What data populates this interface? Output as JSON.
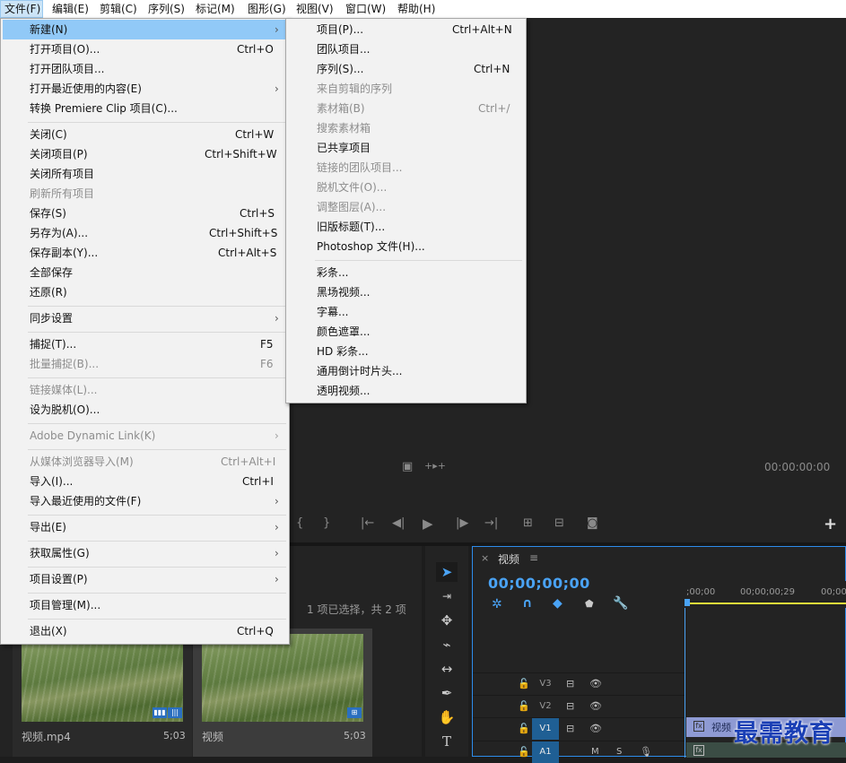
{
  "menubar": {
    "items": [
      "文件(F)",
      "编辑(E)",
      "剪辑(C)",
      "序列(S)",
      "标记(M)",
      "图形(G)",
      "视图(V)",
      "窗口(W)",
      "帮助(H)"
    ]
  },
  "file_menu": {
    "new": {
      "label": "新建(N)"
    },
    "open_project": {
      "label": "打开项目(O)...",
      "shortcut": "Ctrl+O"
    },
    "open_team_project": {
      "label": "打开团队项目..."
    },
    "open_recent": {
      "label": "打开最近使用的内容(E)"
    },
    "convert_clip": {
      "label": "转换 Premiere Clip 项目(C)..."
    },
    "close": {
      "label": "关闭(C)",
      "shortcut": "Ctrl+W"
    },
    "close_project": {
      "label": "关闭项目(P)",
      "shortcut": "Ctrl+Shift+W"
    },
    "close_all_projects": {
      "label": "关闭所有项目"
    },
    "refresh_all_projects": {
      "label": "刷新所有项目"
    },
    "save": {
      "label": "保存(S)",
      "shortcut": "Ctrl+S"
    },
    "save_as": {
      "label": "另存为(A)...",
      "shortcut": "Ctrl+Shift+S"
    },
    "save_copy": {
      "label": "保存副本(Y)...",
      "shortcut": "Ctrl+Alt+S"
    },
    "save_all": {
      "label": "全部保存"
    },
    "revert": {
      "label": "还原(R)"
    },
    "sync_settings": {
      "label": "同步设置"
    },
    "capture": {
      "label": "捕捉(T)...",
      "shortcut": "F5"
    },
    "batch_capture": {
      "label": "批量捕捉(B)...",
      "shortcut": "F6"
    },
    "link_media": {
      "label": "链接媒体(L)..."
    },
    "make_offline": {
      "label": "设为脱机(O)..."
    },
    "dynamic_link": {
      "label": "Adobe Dynamic Link(K)"
    },
    "import_from_browser": {
      "label": "从媒体浏览器导入(M)",
      "shortcut": "Ctrl+Alt+I"
    },
    "import": {
      "label": "导入(I)...",
      "shortcut": "Ctrl+I"
    },
    "import_recent": {
      "label": "导入最近使用的文件(F)"
    },
    "export": {
      "label": "导出(E)"
    },
    "get_properties": {
      "label": "获取属性(G)"
    },
    "project_settings": {
      "label": "项目设置(P)"
    },
    "project_manager": {
      "label": "项目管理(M)..."
    },
    "exit": {
      "label": "退出(X)",
      "shortcut": "Ctrl+Q"
    }
  },
  "new_submenu": {
    "project": {
      "label": "项目(P)...",
      "shortcut": "Ctrl+Alt+N"
    },
    "team_project": {
      "label": "团队项目..."
    },
    "sequence": {
      "label": "序列(S)...",
      "shortcut": "Ctrl+N"
    },
    "sequence_from_clip": {
      "label": "来自剪辑的序列"
    },
    "bin": {
      "label": "素材箱(B)",
      "shortcut": "Ctrl+/"
    },
    "search_bin": {
      "label": "搜索素材箱"
    },
    "shared_project": {
      "label": "已共享项目"
    },
    "linked_team_project": {
      "label": "链接的团队项目..."
    },
    "offline_file": {
      "label": "脱机文件(O)..."
    },
    "adjustment_layer": {
      "label": "调整图层(A)..."
    },
    "legacy_title": {
      "label": "旧版标题(T)..."
    },
    "photoshop_file": {
      "label": "Photoshop 文件(H)..."
    },
    "bars_and_tone": {
      "label": "彩条..."
    },
    "black_video": {
      "label": "黑场视频..."
    },
    "captions": {
      "label": "字幕..."
    },
    "color_matte": {
      "label": "颜色遮罩..."
    },
    "hd_bars": {
      "label": "HD 彩条..."
    },
    "universal_countdown": {
      "label": "通用倒计时片头..."
    },
    "transparent_video": {
      "label": "透明视频..."
    }
  },
  "program_monitor": {
    "timecode": "00:00:00:00"
  },
  "project_panel": {
    "selection_info": "1 项已选择，共 2 项",
    "items": [
      {
        "name": "视频.mp4",
        "duration": "5;03"
      },
      {
        "name": "视频",
        "duration": "5;03"
      }
    ]
  },
  "timeline": {
    "tab_close": "×",
    "tab_title": "视频",
    "tab_menu": "≡",
    "timecode": "00;00;00;00",
    "ruler": [
      ";00;00",
      "00;00;00;29",
      "00;00"
    ],
    "tracks": [
      "V3",
      "V2",
      "V1",
      "A1"
    ],
    "clip_label": "视频",
    "track_toggles": [
      "M",
      "S"
    ]
  },
  "watermark": "最需教育",
  "colors": {
    "menu_highlight": "#91c9f7",
    "timecode_blue": "#4aa3f5",
    "panel_bg": "#232323",
    "selected_track": "#1f5f94"
  }
}
